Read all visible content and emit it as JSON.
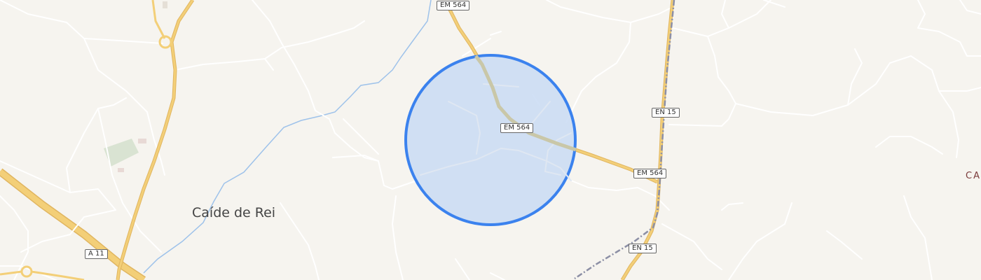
{
  "map": {
    "colors": {
      "background": "#f6f4ef",
      "minor_road": "#ffffff",
      "main_road": "#f3cf78",
      "river": "#9ec2ea",
      "railway": "#8c8fa5",
      "landuse_green": "#d9e3d2",
      "area_circle_fill": "#c9dbf3",
      "area_circle_stroke": "#3b82ee"
    },
    "road_labels": {
      "em564_top": "EM 564",
      "em564_center": "EM 564",
      "em564_right": "EM 564",
      "en15_upper": "EN 15",
      "en15_lower": "EN 15",
      "a11": "A 11"
    },
    "place_labels": {
      "caide_de_rei": "Caíde de Rei",
      "edge_label": "CA"
    }
  }
}
